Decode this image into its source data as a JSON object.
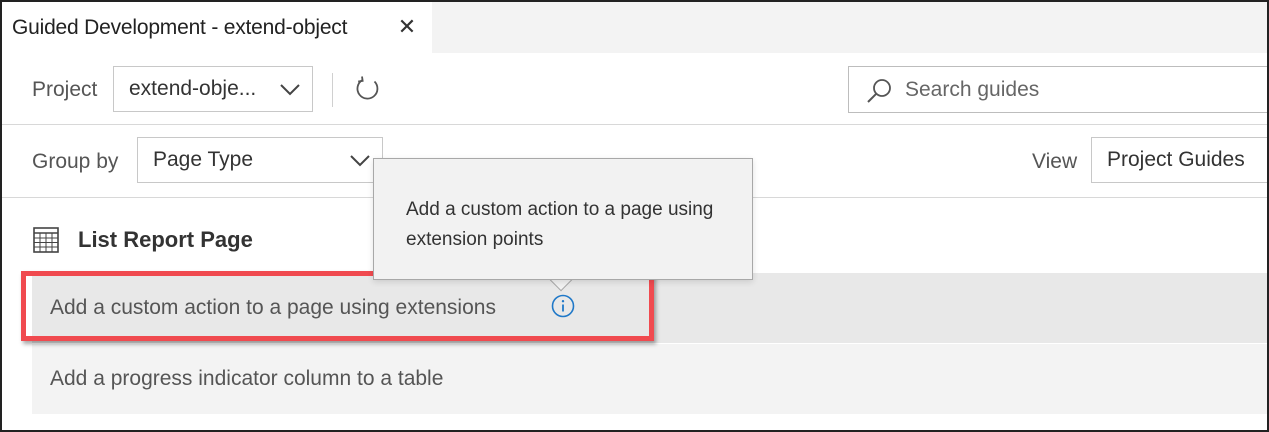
{
  "tab": {
    "title": "Guided Development - extend-object",
    "close_glyph": "✕"
  },
  "toolbar": {
    "project_label": "Project",
    "project_value": "extend-obje...",
    "refresh_icon": "refresh-icon",
    "search_placeholder": "Search guides"
  },
  "groupbar": {
    "group_label": "Group by",
    "group_value": "Page Type",
    "view_label": "View",
    "view_value": "Project Guides"
  },
  "section": {
    "title": "List Report Page",
    "icon": "table-icon"
  },
  "guides": [
    {
      "label": "Add a custom action to a page using extensions",
      "info_icon": "info-icon"
    },
    {
      "label": "Add a progress indicator column to a table"
    }
  ],
  "tooltip": {
    "text": "Add a custom action to a page using extension points"
  },
  "colors": {
    "highlight": "#f04a4f",
    "info": "#1f78c8",
    "row_bg": "#f3f3f3",
    "row_hover_bg": "#e8e8e8"
  }
}
